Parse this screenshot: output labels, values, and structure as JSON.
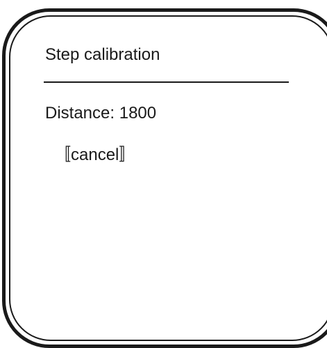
{
  "screen": {
    "title": "Step calibration",
    "distance_label": "Distance:",
    "distance_value": "1800",
    "cancel_label": "〚cancel〛"
  }
}
